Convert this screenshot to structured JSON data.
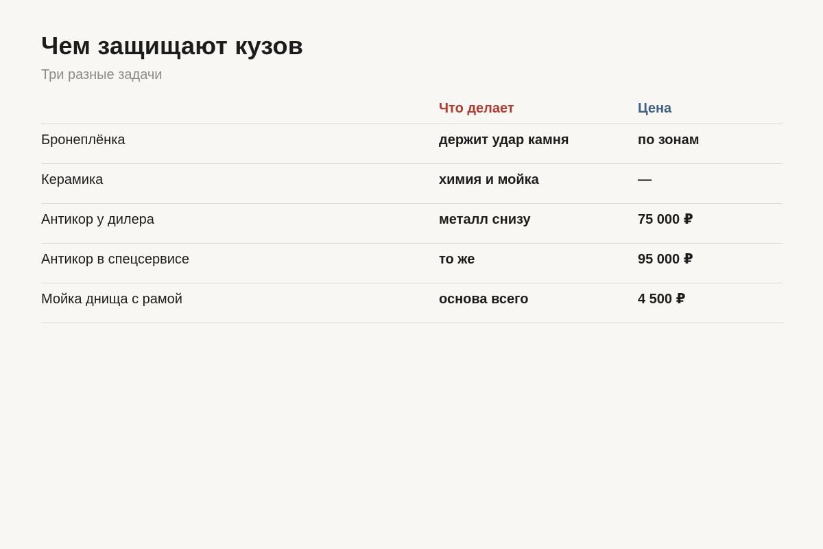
{
  "title": "Чем защищают кузов",
  "subtitle": "Три разные задачи",
  "columns": {
    "what": "Что делает",
    "price": "Цена"
  },
  "colors": {
    "what_header": "#b03a2e",
    "price_header": "#3e5f8a"
  },
  "rows": [
    {
      "name": "Бронеплёнка",
      "what": "держит удар камня",
      "price": "по зонам"
    },
    {
      "name": "Керамика",
      "what": "химия и мойка",
      "price": "—"
    },
    {
      "name": "Антикор у дилера",
      "what": "металл снизу",
      "price": "75 000 ₽"
    },
    {
      "name": "Антикор в спецсервисе",
      "what": "то же",
      "price": "95 000 ₽"
    },
    {
      "name": "Мойка днища с рамой",
      "what": "основа всего",
      "price": "4 500 ₽"
    }
  ]
}
